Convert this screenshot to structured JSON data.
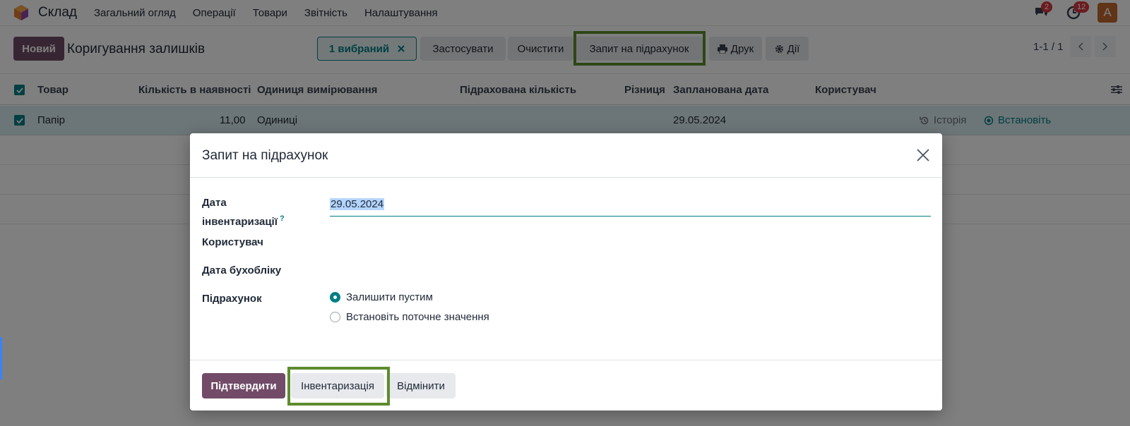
{
  "navbar": {
    "app_name": "Склад",
    "menu": [
      "Загальний огляд",
      "Операції",
      "Товари",
      "Звітність",
      "Налаштування"
    ],
    "messages_badge": "2",
    "activities_badge": "12",
    "avatar_letter": "A"
  },
  "control_panel": {
    "new_label": "Новий",
    "title": "Коригування залишків",
    "selected_label": "1 вибраний",
    "apply_label": "Застосувати",
    "clear_label": "Очистити",
    "request_count_label": "Запит на підрахунок",
    "print_label": "Друк",
    "actions_label": "Дії",
    "pager": "1-1 / 1"
  },
  "table": {
    "columns": [
      "Товар",
      "Кількість в наявності",
      "Одиниця вимірювання",
      "Підрахована кількість",
      "Різниця",
      "Запланована дата",
      "Користувач"
    ],
    "rows": [
      {
        "product": "Папір",
        "on_hand": "11,00",
        "uom": "Одиниці",
        "counted": "",
        "difference": "",
        "scheduled_date": "29.05.2024",
        "user": "",
        "history_label": "Історія",
        "set_label": "Встановіть"
      }
    ]
  },
  "dialog": {
    "title": "Запит на підрахунок",
    "inventory_date_label_line1": "Дата",
    "inventory_date_label_line2": "інвентаризації",
    "help_mark": "?",
    "inventory_date_value": "29.05.2024",
    "user_label": "Користувач",
    "accounting_date_label": "Дата бухобліку",
    "count_label": "Підрахунок",
    "count_options": [
      "Залишити пустим",
      "Встановіть поточне значення"
    ],
    "confirm_label": "Підтвердити",
    "inventory_label": "Інвентаризація",
    "cancel_label": "Відмінити"
  },
  "colors": {
    "brand": "#714b67",
    "accent": "#017e84",
    "highlight": "#5d8c2e",
    "badge": "#d9363e"
  }
}
